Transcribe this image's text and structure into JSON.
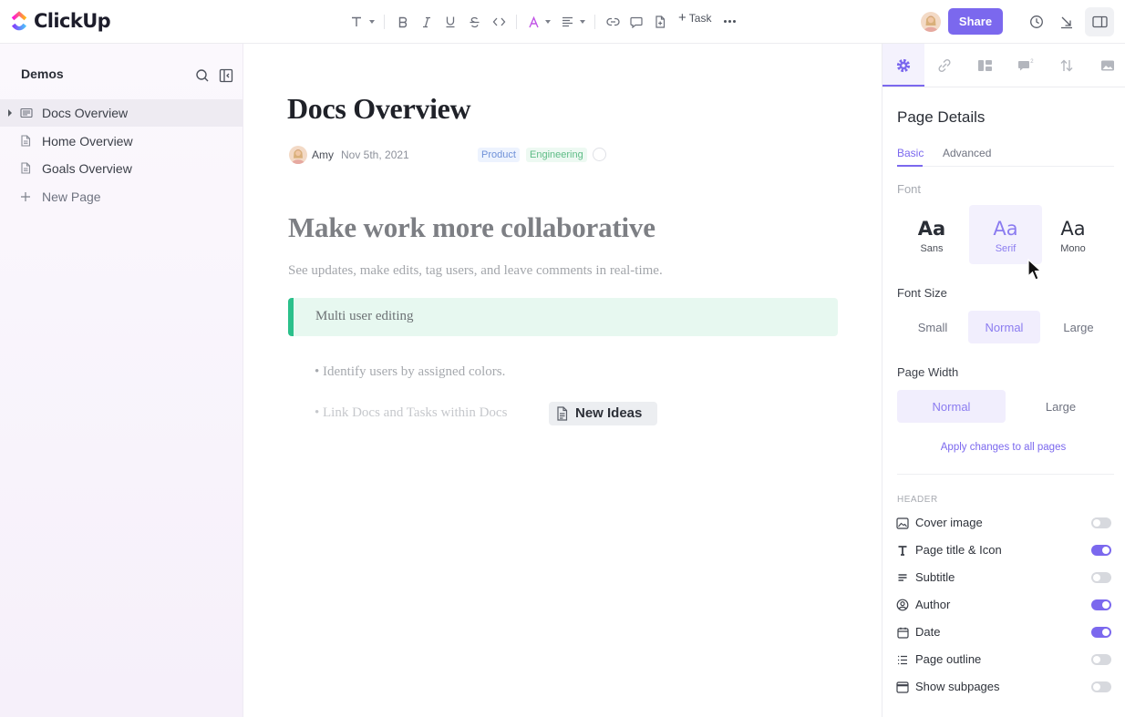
{
  "app": {
    "name": "ClickUp"
  },
  "colors": {
    "accent": "#7b68ee",
    "callout_bar": "#2bc08b"
  },
  "toolbar": {
    "icons": [
      "text-type-icon",
      "bold-icon",
      "italic-icon",
      "underline-icon",
      "strikethrough-icon",
      "code-icon",
      "text-color-icon",
      "align-icon",
      "link-icon",
      "comment-icon",
      "embed-doc-icon"
    ],
    "task_label": "Task",
    "share_label": "Share"
  },
  "sidebar": {
    "title": "Demos",
    "items": [
      {
        "label": "Docs Overview"
      },
      {
        "label": "Home Overview"
      },
      {
        "label": "Goals Overview"
      },
      {
        "label": "New Page"
      }
    ]
  },
  "doc": {
    "title": "Docs Overview",
    "author": "Amy",
    "date": "Nov 5th, 2021",
    "tags": [
      "Product",
      "Engineering"
    ],
    "heading": "Make work more collaborative",
    "subtitle": "See updates, make edits, tag users, and leave comments in real-time.",
    "callout": "Multi user editing",
    "bullets": [
      "• Identify users by assigned colors.",
      "• Link Docs and Tasks within Docs"
    ],
    "chip_label": "New Ideas"
  },
  "panel": {
    "title": "Page Details",
    "tabs": [
      "Basic",
      "Advanced"
    ],
    "font_label": "Font",
    "fonts": [
      {
        "sample": "Aa",
        "name": "Sans"
      },
      {
        "sample": "Aa",
        "name": "Serif"
      },
      {
        "sample": "Aa",
        "name": "Mono"
      }
    ],
    "font_size_label": "Font Size",
    "font_sizes": [
      "Small",
      "Normal",
      "Large"
    ],
    "page_width_label": "Page Width",
    "page_widths": [
      "Normal",
      "Large"
    ],
    "apply_label": "Apply changes to all pages",
    "header_label": "HEADER",
    "toggles": [
      {
        "label": "Cover image",
        "on": false,
        "icon": "image-icon"
      },
      {
        "label": "Page title & Icon",
        "on": true,
        "icon": "title-icon"
      },
      {
        "label": "Subtitle",
        "on": false,
        "icon": "subtitle-icon"
      },
      {
        "label": "Author",
        "on": true,
        "icon": "author-icon"
      },
      {
        "label": "Date",
        "on": true,
        "icon": "calendar-icon"
      },
      {
        "label": "Page outline",
        "on": false,
        "icon": "outline-icon"
      },
      {
        "label": "Show subpages",
        "on": false,
        "icon": "subpages-icon"
      }
    ]
  }
}
